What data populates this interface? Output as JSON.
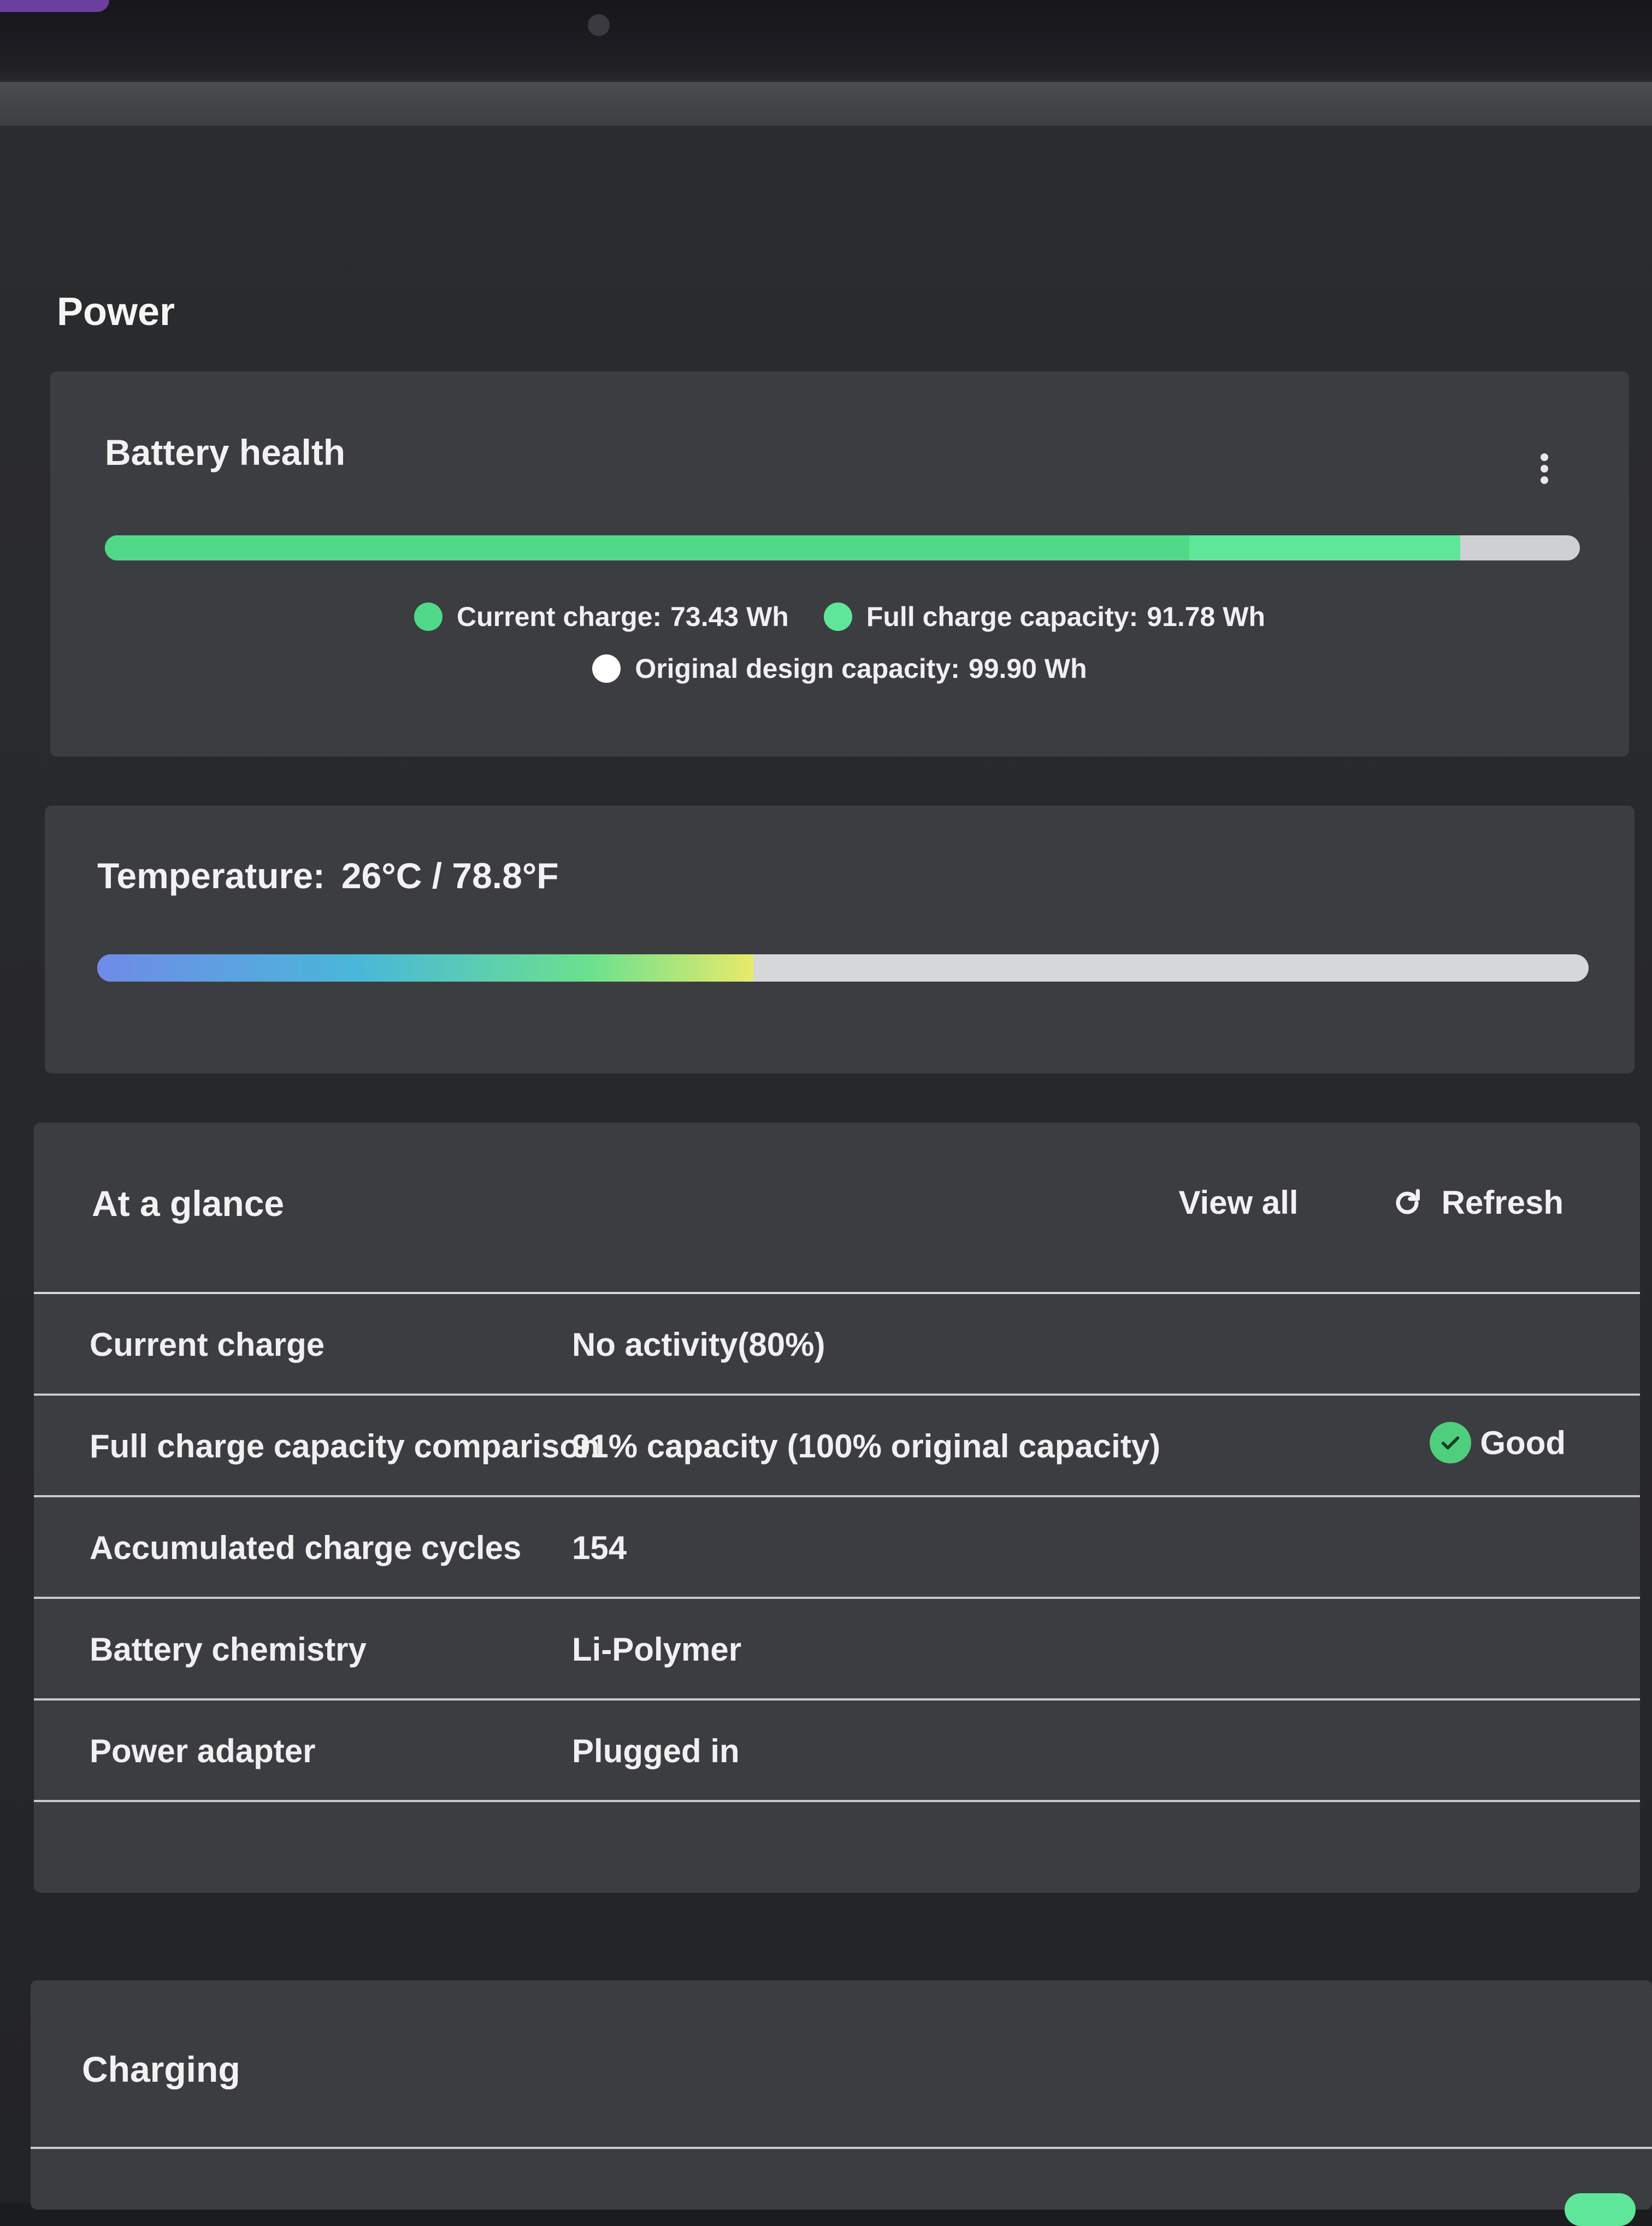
{
  "page": {
    "title": "Power"
  },
  "battery_health": {
    "title": "Battery health",
    "current_charge_wh": 73.43,
    "full_charge_capacity_wh": 91.78,
    "design_capacity_wh": 99.9,
    "legend": {
      "current_label": "Current charge:",
      "current_value": "73.43 Wh",
      "full_label": "Full charge capacity:",
      "full_value": "91.78 Wh",
      "design_label": "Original design capacity:",
      "design_value": "99.90 Wh"
    },
    "colors": {
      "current": "#4fd989",
      "full": "#5ee79a",
      "design": "#ffffff",
      "track": "#cfd0d2"
    }
  },
  "temperature": {
    "label": "Temperature:",
    "value": "26°C / 78.8°F",
    "level_fraction": 0.44
  },
  "at_a_glance": {
    "title": "At a glance",
    "view_all_label": "View all",
    "refresh_label": "Refresh",
    "rows": [
      {
        "label": "Current charge",
        "value": "No activity(80%)"
      },
      {
        "label": "Full charge capacity comparison",
        "value": "91% capacity (100% original capacity)",
        "status": "Good"
      },
      {
        "label": "Accumulated charge cycles",
        "value": "154"
      },
      {
        "label": "Battery chemistry",
        "value": "Li-Polymer"
      },
      {
        "label": "Power adapter",
        "value": "Plugged in"
      }
    ],
    "status_color": "#4fcf7d"
  },
  "charging": {
    "title": "Charging"
  }
}
